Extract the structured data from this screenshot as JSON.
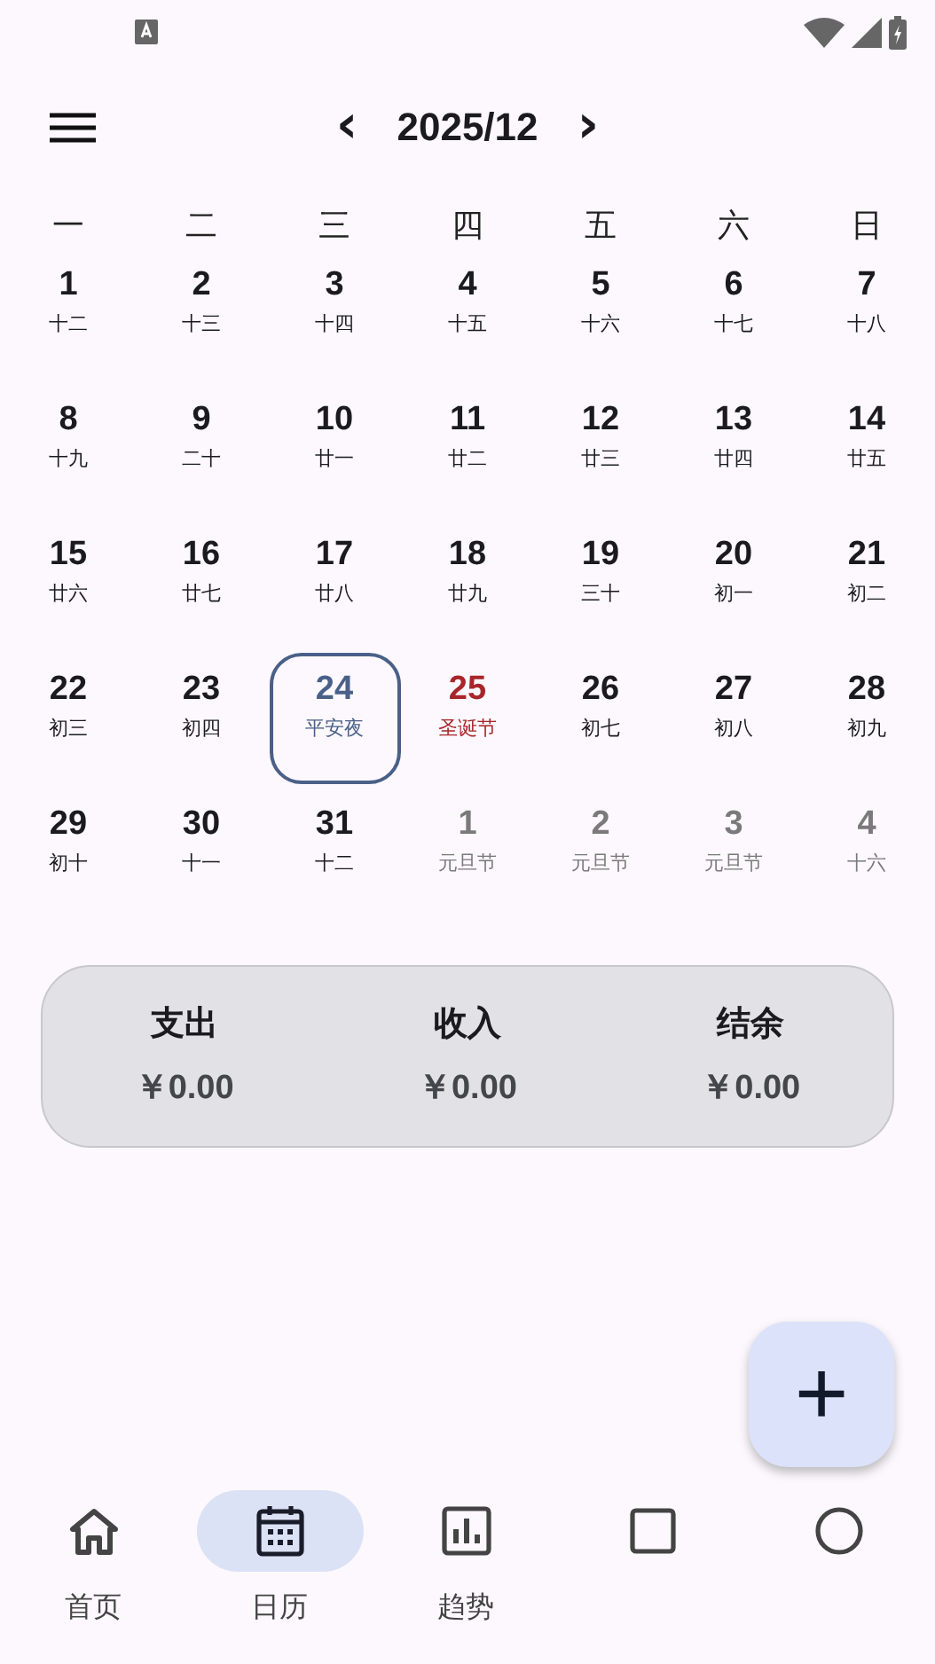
{
  "header": {
    "title": "2025/12",
    "prev": "‹",
    "next": "›"
  },
  "weekdays": [
    "一",
    "二",
    "三",
    "四",
    "五",
    "六",
    "日"
  ],
  "days": [
    {
      "day": "1",
      "lunar": "十二",
      "kind": "normal",
      "selected": false
    },
    {
      "day": "2",
      "lunar": "十三",
      "kind": "normal",
      "selected": false
    },
    {
      "day": "3",
      "lunar": "十四",
      "kind": "normal",
      "selected": false
    },
    {
      "day": "4",
      "lunar": "十五",
      "kind": "normal",
      "selected": false
    },
    {
      "day": "5",
      "lunar": "十六",
      "kind": "normal",
      "selected": false
    },
    {
      "day": "6",
      "lunar": "十七",
      "kind": "normal",
      "selected": false
    },
    {
      "day": "7",
      "lunar": "十八",
      "kind": "normal",
      "selected": false
    },
    {
      "day": "8",
      "lunar": "十九",
      "kind": "normal",
      "selected": false
    },
    {
      "day": "9",
      "lunar": "二十",
      "kind": "normal",
      "selected": false
    },
    {
      "day": "10",
      "lunar": "廿一",
      "kind": "normal",
      "selected": false
    },
    {
      "day": "11",
      "lunar": "廿二",
      "kind": "normal",
      "selected": false
    },
    {
      "day": "12",
      "lunar": "廿三",
      "kind": "normal",
      "selected": false
    },
    {
      "day": "13",
      "lunar": "廿四",
      "kind": "normal",
      "selected": false
    },
    {
      "day": "14",
      "lunar": "廿五",
      "kind": "normal",
      "selected": false
    },
    {
      "day": "15",
      "lunar": "廿六",
      "kind": "normal",
      "selected": false
    },
    {
      "day": "16",
      "lunar": "廿七",
      "kind": "normal",
      "selected": false
    },
    {
      "day": "17",
      "lunar": "廿八",
      "kind": "normal",
      "selected": false
    },
    {
      "day": "18",
      "lunar": "廿九",
      "kind": "normal",
      "selected": false
    },
    {
      "day": "19",
      "lunar": "三十",
      "kind": "normal",
      "selected": false
    },
    {
      "day": "20",
      "lunar": "初一",
      "kind": "normal",
      "selected": false
    },
    {
      "day": "21",
      "lunar": "初二",
      "kind": "normal",
      "selected": false
    },
    {
      "day": "22",
      "lunar": "初三",
      "kind": "normal",
      "selected": false
    },
    {
      "day": "23",
      "lunar": "初四",
      "kind": "normal",
      "selected": false
    },
    {
      "day": "24",
      "lunar": "平安夜",
      "kind": "normal",
      "selected": true
    },
    {
      "day": "25",
      "lunar": "圣诞节",
      "kind": "holiday",
      "selected": false
    },
    {
      "day": "26",
      "lunar": "初七",
      "kind": "normal",
      "selected": false
    },
    {
      "day": "27",
      "lunar": "初八",
      "kind": "normal",
      "selected": false
    },
    {
      "day": "28",
      "lunar": "初九",
      "kind": "normal",
      "selected": false
    },
    {
      "day": "29",
      "lunar": "初十",
      "kind": "normal",
      "selected": false
    },
    {
      "day": "30",
      "lunar": "十一",
      "kind": "normal",
      "selected": false
    },
    {
      "day": "31",
      "lunar": "十二",
      "kind": "normal",
      "selected": false
    },
    {
      "day": "1",
      "lunar": "元旦节",
      "kind": "outside",
      "selected": false
    },
    {
      "day": "2",
      "lunar": "元旦节",
      "kind": "outside",
      "selected": false
    },
    {
      "day": "3",
      "lunar": "元旦节",
      "kind": "outside",
      "selected": false
    },
    {
      "day": "4",
      "lunar": "十六",
      "kind": "outside",
      "selected": false
    }
  ],
  "summary": [
    {
      "label": "支出",
      "amount": "￥0.00"
    },
    {
      "label": "收入",
      "amount": "￥0.00"
    },
    {
      "label": "结余",
      "amount": "￥0.00"
    }
  ],
  "fab": {
    "symbol": "+"
  },
  "nav": [
    {
      "label": "首页",
      "selected": false
    },
    {
      "label": "日历",
      "selected": true
    },
    {
      "label": "趋势",
      "selected": false
    },
    {
      "selected": false
    },
    {
      "selected": false
    }
  ]
}
